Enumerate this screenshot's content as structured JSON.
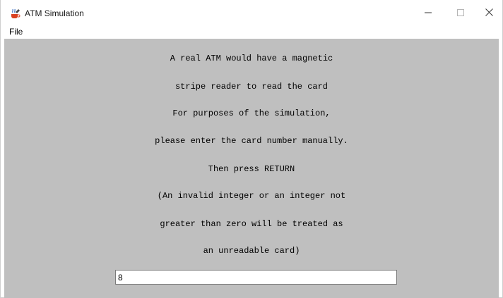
{
  "window": {
    "title": "ATM Simulation",
    "icon": "java-cup-icon"
  },
  "window_controls": {
    "minimize_icon": "minimize-icon",
    "maximize_icon": "maximize-icon",
    "close_icon": "close-icon"
  },
  "menubar": {
    "items": [
      {
        "label": "File"
      }
    ]
  },
  "content": {
    "background": "#bfbfbf",
    "lines": [
      "A real ATM would have a magnetic",
      "stripe reader to read the card",
      "For purposes of the simulation,",
      "please enter the card number manually.",
      "Then press RETURN",
      "(An invalid integer or an integer not",
      "greater than zero will be treated as",
      "an unreadable card)"
    ],
    "card_input": {
      "value": "8"
    }
  }
}
